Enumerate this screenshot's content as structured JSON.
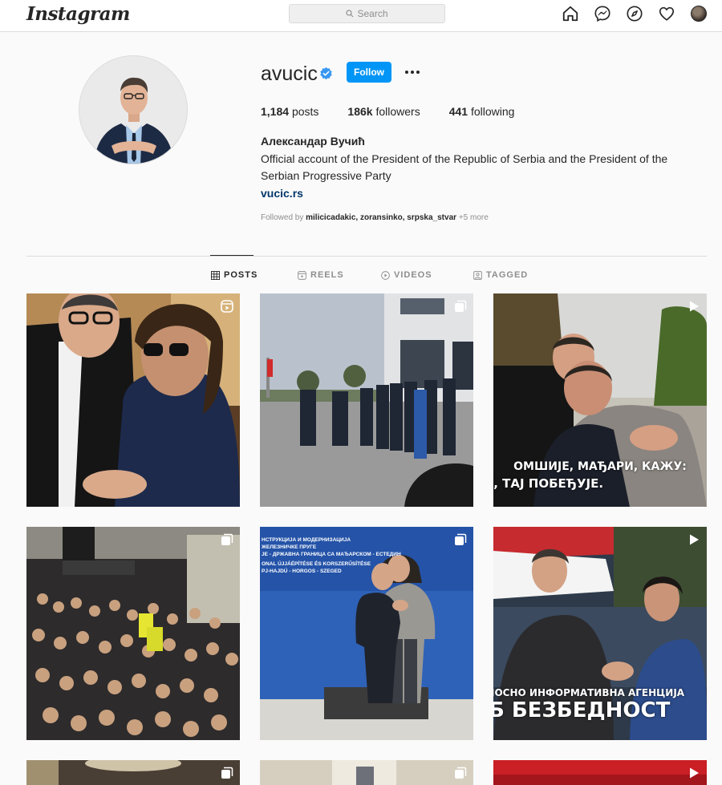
{
  "topbar": {
    "logo": "Instagram",
    "search_placeholder": "Search",
    "icons": [
      "home-icon",
      "messenger-icon",
      "explore-icon",
      "heart-icon",
      "profile-avatar"
    ]
  },
  "profile": {
    "username": "avucic",
    "follow_label": "Follow",
    "posts_count": "1,184",
    "posts_label": "posts",
    "followers_count": "186k",
    "followers_label": "followers",
    "following_count": "441",
    "following_label": "following",
    "full_name": "Александар Вучић",
    "bio": "Official account of the President of the Republic of Serbia and the President of the Serbian Progressive Party",
    "link": "vucic.rs",
    "followed_by_prefix": "Followed by",
    "followed_by_users": "milicicadakic, zoransinko, srpska_stvar",
    "followed_by_more": "+5 more"
  },
  "tabs": [
    {
      "label": "POSTS",
      "active": true
    },
    {
      "label": "REELS",
      "active": false
    },
    {
      "label": "VIDEOS",
      "active": false
    },
    {
      "label": "TAGGED",
      "active": false
    }
  ],
  "posts": [
    {
      "type": "reel"
    },
    {
      "type": "carousel"
    },
    {
      "type": "video",
      "overlay_line1": "ОМШИЈЕ, МАЂАРИ, КАЖУ:",
      "overlay_line2": "Е, ТАЈ ПОБЕЂУЈЕ."
    },
    {
      "type": "carousel"
    },
    {
      "type": "carousel",
      "banner_line1": "НСТРУКЦИЈА И МОДЕРНИЗАЦИЈА",
      "banner_line2": "ЖЕЛЕЗНИЧКЕ ПРУГЕ",
      "banner_line3": "ЈЕ - ДРЖАВНА ГРАНИЦА СА МАЂАРСКОМ - ЕСТЕДИН",
      "banner_line4": "ONAL ÚJJÁÉPÍTÉSE ÉS KORSZERŰSÍTÉSE",
      "banner_line5": "PJ-HAJDÚ - HORGOS - SZEGED"
    },
    {
      "type": "video",
      "overlay_line1": "ЈОСНО ИНФОРМАТИВНА АГЕНЦИЈА",
      "overlay_line2": "Б БЕЗБЕДНОСТ"
    }
  ],
  "colors": {
    "accent": "#0095f6",
    "link": "#00376b",
    "verified": "#3897f0"
  }
}
